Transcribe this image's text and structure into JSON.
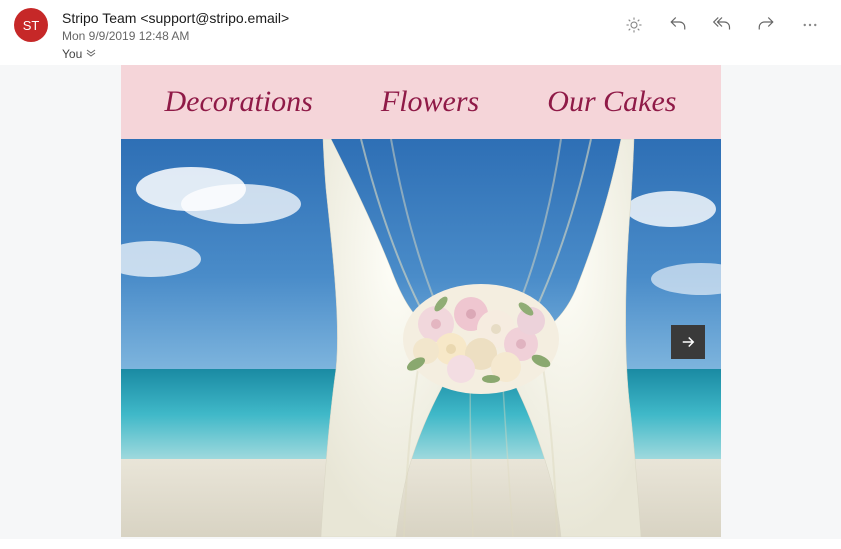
{
  "header": {
    "avatar_initials": "ST",
    "sender_display": "Stripo Team <support@stripo.email>",
    "date": "Mon 9/9/2019 12:48 AM",
    "to_label": "You"
  },
  "nav": {
    "item1": "Decorations",
    "item2": "Flowers",
    "item3": "Our Cakes"
  }
}
